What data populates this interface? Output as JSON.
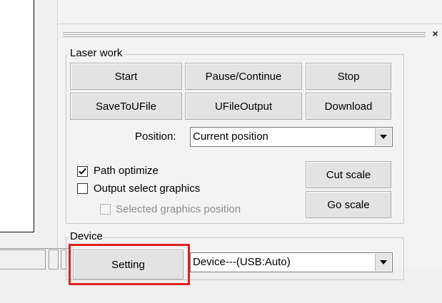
{
  "laser_work": {
    "title": "Laser work",
    "buttons": {
      "start": "Start",
      "pause_continue": "Pause/Continue",
      "stop": "Stop",
      "save_to_ufile": "SaveToUFile",
      "ufile_output": "UFileOutput",
      "download": "Download",
      "cut_scale": "Cut scale",
      "go_scale": "Go scale"
    },
    "position_label": "Position:",
    "position_value": "Current position",
    "checkboxes": {
      "path_optimize": {
        "label": "Path optimize",
        "checked": true
      },
      "output_select_graphics": {
        "label": "Output select graphics",
        "checked": false
      },
      "selected_graphics_position": {
        "label": "Selected graphics position",
        "checked": false,
        "enabled": false
      }
    }
  },
  "device": {
    "title": "Device",
    "setting_label": "Setting",
    "device_value": "Device---(USB:Auto)"
  },
  "dock_close_symbol": "×",
  "highlight_color": "#e02020"
}
